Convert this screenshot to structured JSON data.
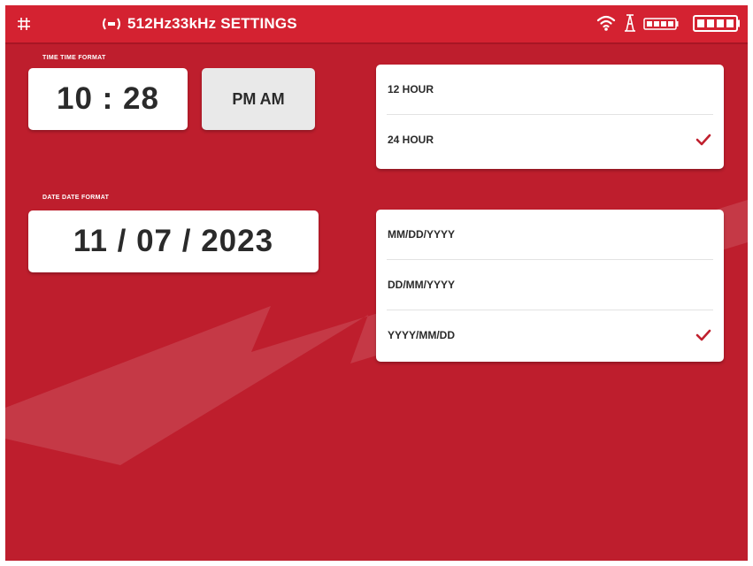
{
  "header": {
    "title": "512Hz33kHz SETTINGS",
    "icons": [
      "grid-icon",
      "signal-icon",
      "wifi-icon",
      "tower-icon",
      "battery-small-icon",
      "battery-icon"
    ]
  },
  "time": {
    "label": "TIME TIME FORMAT",
    "value": "10 : 28",
    "ampm": "PM AM"
  },
  "date": {
    "label": "DATE DATE FORMAT",
    "value": "11 / 07 / 2023"
  },
  "hour_formats": {
    "options": [
      {
        "label": "12 HOUR",
        "selected": false
      },
      {
        "label": "24 HOUR",
        "selected": true
      }
    ]
  },
  "date_formats": {
    "options": [
      {
        "label": "MM/DD/YYYY",
        "selected": false
      },
      {
        "label": "DD/MM/YYYY",
        "selected": false
      },
      {
        "label": "YYYY/MM/DD",
        "selected": true
      }
    ]
  },
  "colors": {
    "background": "#be1e2d",
    "header": "#d42231",
    "accent_check": "#c0202e",
    "text_dark": "#2a2a2a"
  }
}
